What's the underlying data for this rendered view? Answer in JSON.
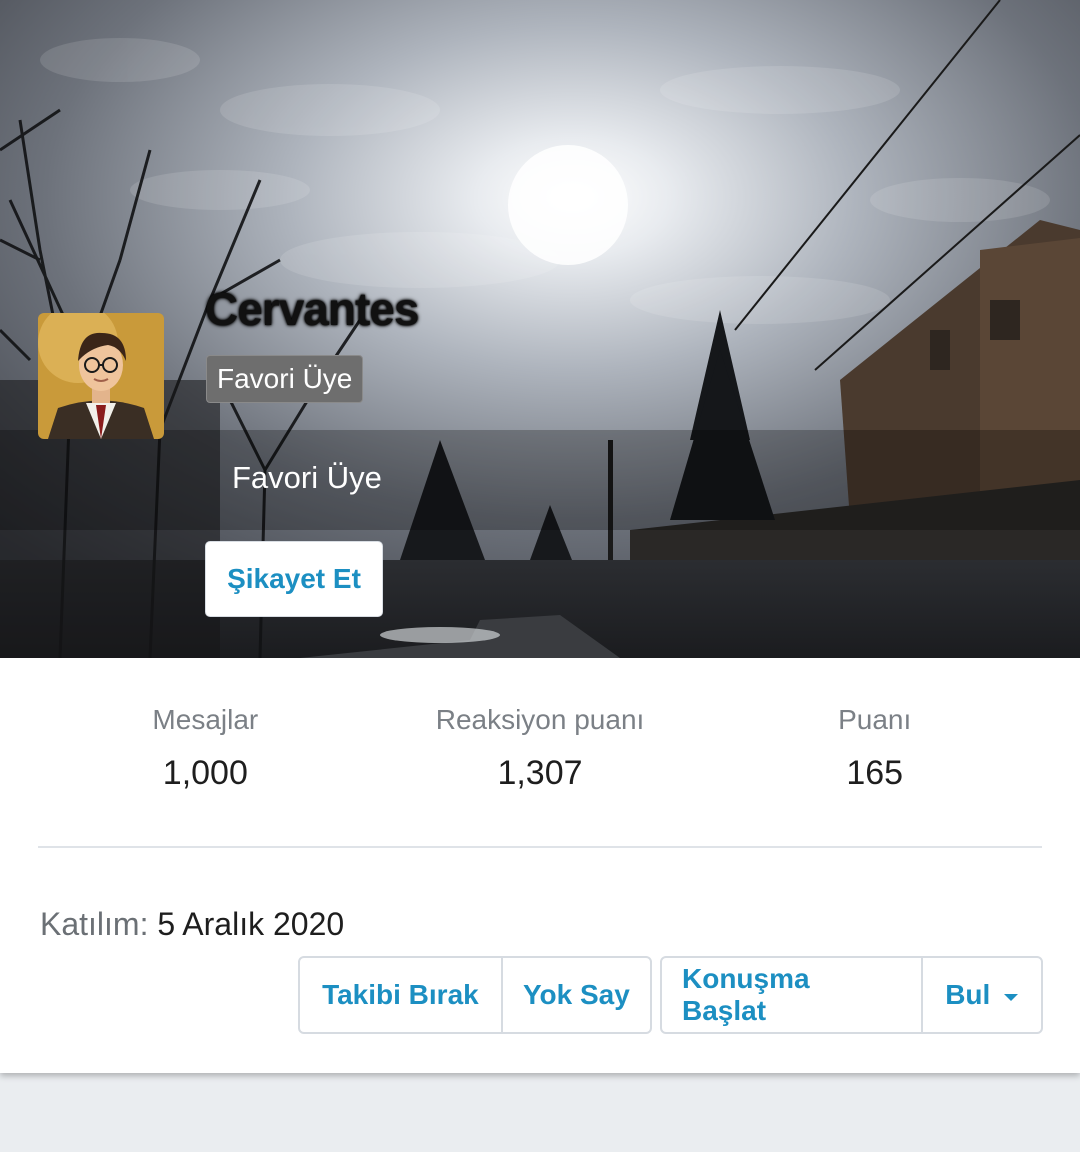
{
  "profile": {
    "username": "Cervantes",
    "user_badge": "Favori Üye",
    "user_title": "Favori Üye",
    "report_label": "Şikayet Et",
    "avatar_icon": "avatar-portrait-icon"
  },
  "stats": {
    "messages_label": "Mesajlar",
    "messages_value": "1,000",
    "reaction_label": "Reaksiyon puanı",
    "reaction_value": "1,307",
    "points_label": "Puanı",
    "points_value": "165"
  },
  "joined": {
    "label": "Katılım:",
    "date": "5 Aralık 2020"
  },
  "actions": {
    "unfollow": "Takibi Bırak",
    "ignore": "Yok Say",
    "start_conversation": "Konuşma Başlat",
    "find": "Bul"
  },
  "colors": {
    "accent": "#1c8fc2",
    "badge_bg": "#6e6e6e",
    "page_bg": "#eaedf0"
  }
}
